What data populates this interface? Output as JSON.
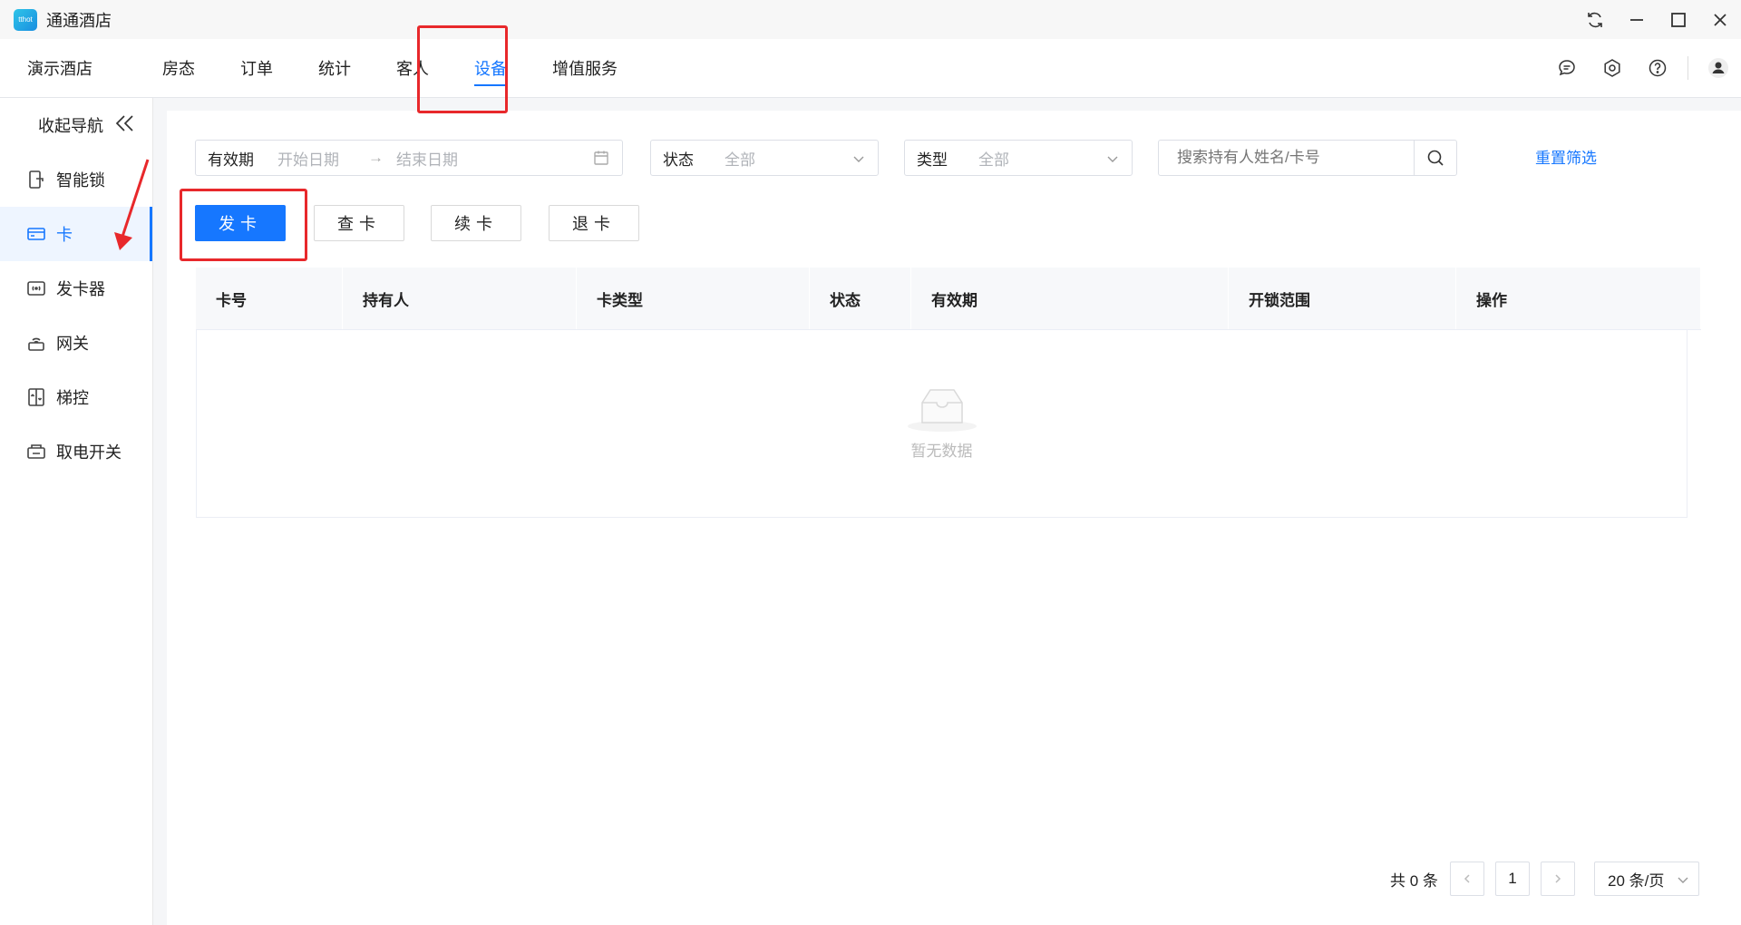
{
  "app": {
    "title": "通通酒店",
    "logo_text": "tthot"
  },
  "nav": {
    "items": [
      "演示酒店",
      "房态",
      "订单",
      "统计",
      "客人",
      "设备",
      "增值服务"
    ],
    "active": "设备"
  },
  "sidebar": {
    "collapse_label": "收起导航",
    "items": [
      {
        "label": "智能锁",
        "icon": "smart-lock-icon"
      },
      {
        "label": "卡",
        "icon": "card-icon"
      },
      {
        "label": "发卡器",
        "icon": "card-encoder-icon"
      },
      {
        "label": "网关",
        "icon": "gateway-icon"
      },
      {
        "label": "梯控",
        "icon": "elevator-icon"
      },
      {
        "label": "取电开关",
        "icon": "power-switch-icon"
      }
    ],
    "active": "卡"
  },
  "filters": {
    "validity_label": "有效期",
    "start_placeholder": "开始日期",
    "end_placeholder": "结束日期",
    "status_label": "状态",
    "status_value": "全部",
    "type_label": "类型",
    "type_value": "全部",
    "search_placeholder": "搜索持有人姓名/卡号",
    "reset_label": "重置筛选"
  },
  "actions": {
    "issue": "发卡",
    "query": "查卡",
    "renew": "续卡",
    "return": "退卡"
  },
  "table": {
    "columns": [
      "卡号",
      "持有人",
      "卡类型",
      "状态",
      "有效期",
      "开锁范围",
      "操作"
    ],
    "empty_text": "暂无数据"
  },
  "pagination": {
    "total": "共 0 条",
    "page": "1",
    "page_size": "20 条/页"
  },
  "colors": {
    "accent": "#1677ff",
    "annotation": "#e8282b"
  }
}
